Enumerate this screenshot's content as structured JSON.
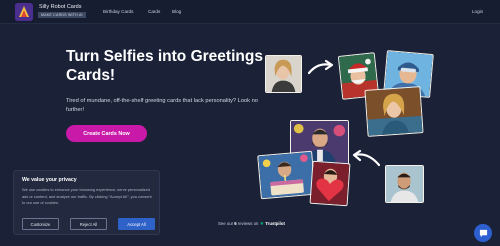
{
  "nav": {
    "brand_name": "Silly Robot Cards",
    "brand_tagline": "MAKE CARDS WITH AI",
    "links": [
      "Birthday Cards",
      "Cards",
      "Blog"
    ],
    "login": "Login"
  },
  "hero": {
    "title": "Turn Selfies into Greetings Cards!",
    "description": "Tired of mundane, off-the-shelf greeting cards that lack personality? Look no further!",
    "cta": "Create Cards Now"
  },
  "reviews": {
    "prefix": "See our",
    "count": "6",
    "suffix": "reviews on",
    "platform": "Trustpilot"
  },
  "consent": {
    "title": "We value your privacy",
    "text": "We use cookies to enhance your browsing experience, serve personalized ads or content, and analyze our traffic. By clicking \"Accept All\", you consent to our use of cookies.",
    "buttons": {
      "customize": "Customize",
      "reject": "Reject All",
      "accept": "Accept All"
    }
  },
  "icons": {
    "logo": "robot-logo-icon",
    "chat": "chat-bubble-icon",
    "arrow": "curved-arrow-icon",
    "trustpilot": "trustpilot-star-icon"
  },
  "colors": {
    "background": "#1b2238",
    "cta": "#c819a8",
    "accept": "#2f62c9",
    "trustpilot": "#00b67a"
  }
}
